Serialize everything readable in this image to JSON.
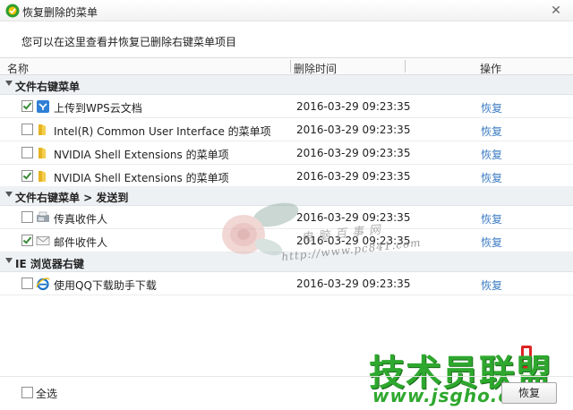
{
  "window": {
    "title": "恢复删除的菜单",
    "close_glyph": "✕"
  },
  "description": "您可以在这里查看并恢复已删除右键菜单项目",
  "columns": {
    "name": "名称",
    "time": "删除时间",
    "action": "操作"
  },
  "groups": [
    {
      "title": "文件右键菜单",
      "items": [
        {
          "checked": true,
          "icon": "wps-cloud-icon",
          "name": "上传到WPS云文档",
          "time": "2016-03-29 09:23:35",
          "action": "恢复"
        },
        {
          "checked": false,
          "icon": "folder-icon",
          "name": "Intel(R) Common User Interface 的菜单项",
          "time": "2016-03-29 09:23:35",
          "action": "恢复"
        },
        {
          "checked": false,
          "icon": "folder-icon",
          "name": "NVIDIA Shell Extensions 的菜单项",
          "time": "2016-03-29 09:23:35",
          "action": "恢复"
        },
        {
          "checked": true,
          "icon": "folder-icon",
          "name": "NVIDIA Shell Extensions 的菜单项",
          "time": "2016-03-29 09:23:35",
          "action": "恢复"
        }
      ]
    },
    {
      "title": "文件右键菜单 > 发送到",
      "items": [
        {
          "checked": false,
          "icon": "fax-icon",
          "name": "传真收件人",
          "time": "2016-03-29 09:23:35",
          "action": "恢复"
        },
        {
          "checked": true,
          "icon": "mail-icon",
          "name": "邮件收件人",
          "time": "2016-03-29 09:23:35",
          "action": "恢复"
        }
      ]
    },
    {
      "title": "IE 浏览器右键",
      "items": [
        {
          "checked": false,
          "icon": "ie-icon",
          "name": "使用QQ下载助手下载",
          "time": "2016-03-29 09:23:35",
          "action": "恢复"
        }
      ]
    }
  ],
  "footer": {
    "select_all": "全选",
    "restore_button": "恢复",
    "select_all_checked": false
  },
  "watermarks": {
    "site_cn": "电脑百事网",
    "site_url": "http://www.pc841.com",
    "logo_text": "技术员联盟",
    "logo_url": "www.jsgho.com"
  },
  "colors": {
    "accent_link": "#3d7dc4",
    "group_bg": "#eef1f4",
    "logo_green": "#2ea82e",
    "check_green": "#3a8a3a"
  }
}
